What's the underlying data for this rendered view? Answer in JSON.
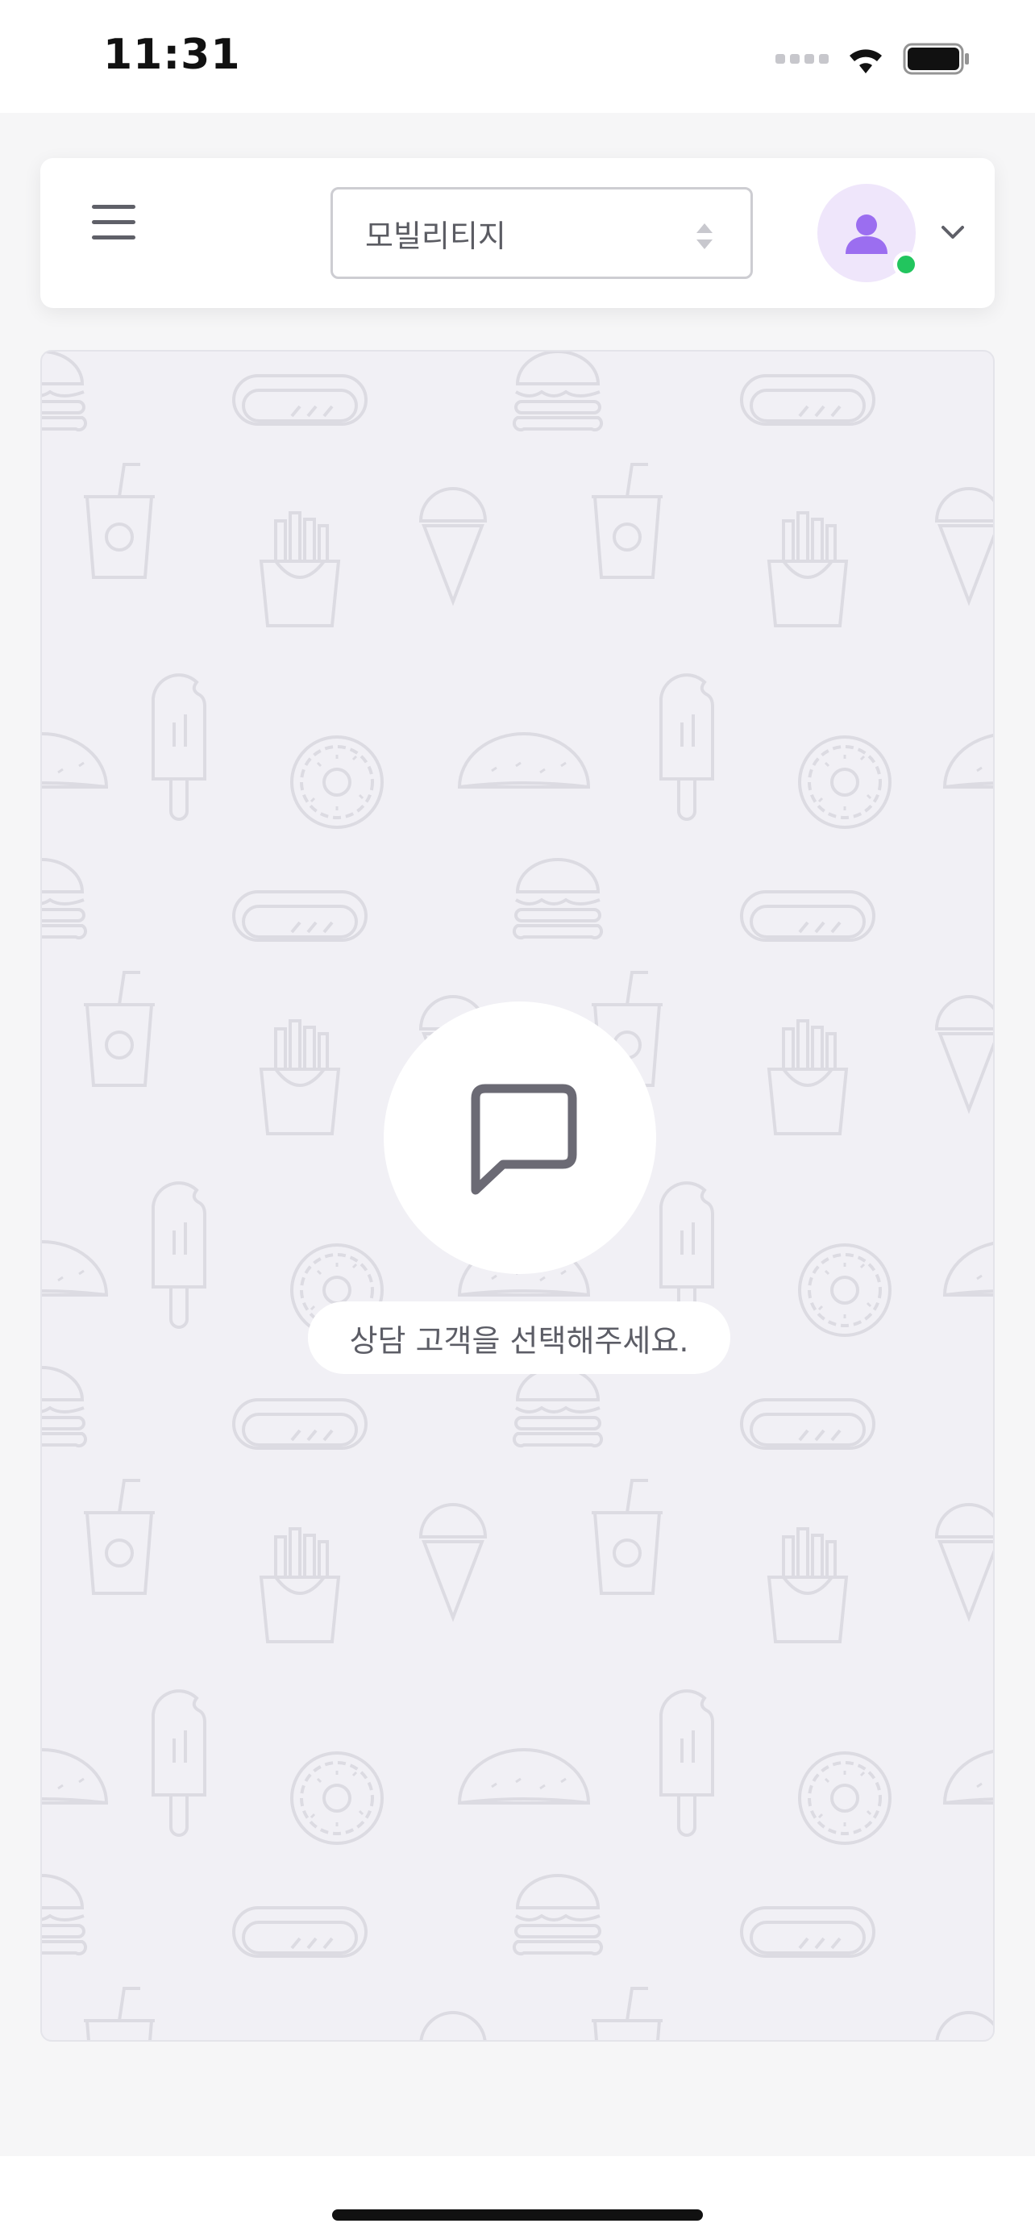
{
  "status_bar": {
    "time": "11:31",
    "icons": [
      "signal-icon",
      "wifi-icon",
      "battery-icon"
    ]
  },
  "header": {
    "menu_icon": "hamburger-menu-icon",
    "organization_select": {
      "selected": "모빌리티지"
    },
    "avatar_icon": "user-icon",
    "online_status_color": "#22c55e",
    "dropdown_icon": "chevron-down-icon"
  },
  "chat_area": {
    "background_pattern": "food-doodle-pattern",
    "empty_state": {
      "icon": "chat-bubble-icon",
      "message": "상담 고객을 선택해주세요."
    }
  },
  "colors": {
    "accent": "#9b6ef0",
    "avatar_bg": "#efe6fb",
    "chat_bg": "#f1f0f5"
  }
}
